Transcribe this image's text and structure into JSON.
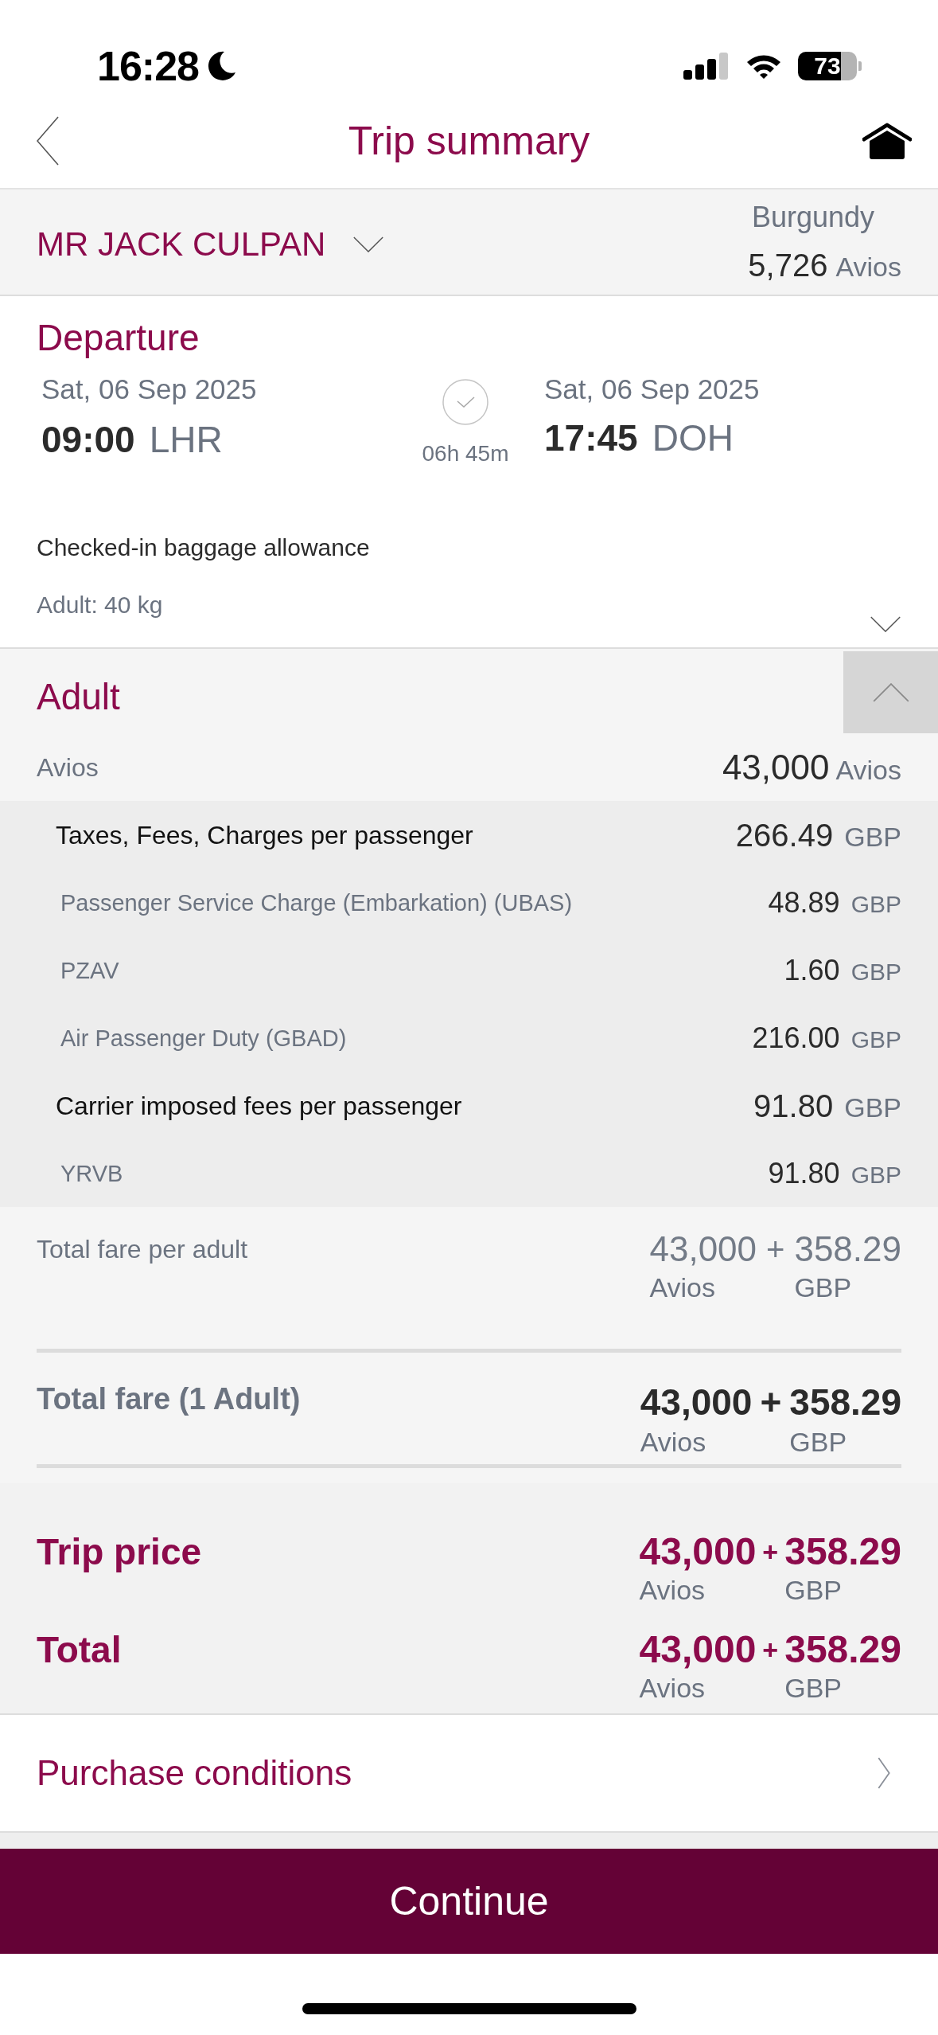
{
  "status_bar": {
    "time": "16:28",
    "battery": "73"
  },
  "header": {
    "title": "Trip summary"
  },
  "passenger": {
    "name": "MR JACK CULPAN",
    "tier": "Burgundy",
    "points": "5,726",
    "points_unit": "Avios"
  },
  "flight": {
    "title": "Departure",
    "departure": {
      "date": "Sat, 06 Sep 2025",
      "time": "09:00",
      "airport": "LHR"
    },
    "duration": "06h 45m",
    "arrival": {
      "date": "Sat, 06 Sep 2025",
      "time": "17:45",
      "airport": "DOH"
    },
    "baggage_title": "Checked-in baggage allowance",
    "baggage": "Adult: 40 kg",
    "expanded": false
  },
  "fare": {
    "title": "Adult",
    "expanded": true,
    "avios": {
      "label": "Avios",
      "amount": "43,000",
      "unit": "Avios"
    },
    "charges": [
      {
        "kind": "group",
        "label": "Taxes, Fees, Charges per passenger",
        "amount": "266.49",
        "unit": "GBP"
      },
      {
        "kind": "item",
        "label": "Passenger Service Charge (Embarkation) (UBAS)",
        "amount": "48.89",
        "unit": "GBP"
      },
      {
        "kind": "item",
        "label": "PZAV",
        "amount": "1.60",
        "unit": "GBP"
      },
      {
        "kind": "item",
        "label": "Air Passenger Duty (GBAD)",
        "amount": "216.00",
        "unit": "GBP"
      },
      {
        "kind": "group",
        "label": "Carrier imposed fees per passenger",
        "amount": "91.80",
        "unit": "GBP"
      },
      {
        "kind": "item",
        "label": "YRVB",
        "amount": "91.80",
        "unit": "GBP"
      }
    ],
    "per_adult": {
      "label": "Total fare per adult",
      "avios": "43,000",
      "avios_unit": "Avios",
      "plus": "+",
      "money": "358.29",
      "money_unit": "GBP"
    },
    "total": {
      "label": "Total fare (1 Adult)",
      "avios": "43,000",
      "avios_unit": "Avios",
      "plus": "+",
      "money": "358.29",
      "money_unit": "GBP"
    }
  },
  "summary": [
    {
      "label": "Trip price",
      "avios": "43,000",
      "avios_unit": "Avios",
      "plus": "+",
      "money": "358.29",
      "money_unit": "GBP"
    },
    {
      "label": "Total",
      "avios": "43,000",
      "avios_unit": "Avios",
      "plus": "+",
      "money": "358.29",
      "money_unit": "GBP"
    }
  ],
  "purchase_conditions": {
    "label": "Purchase conditions"
  },
  "continue_button": {
    "label": "Continue"
  }
}
